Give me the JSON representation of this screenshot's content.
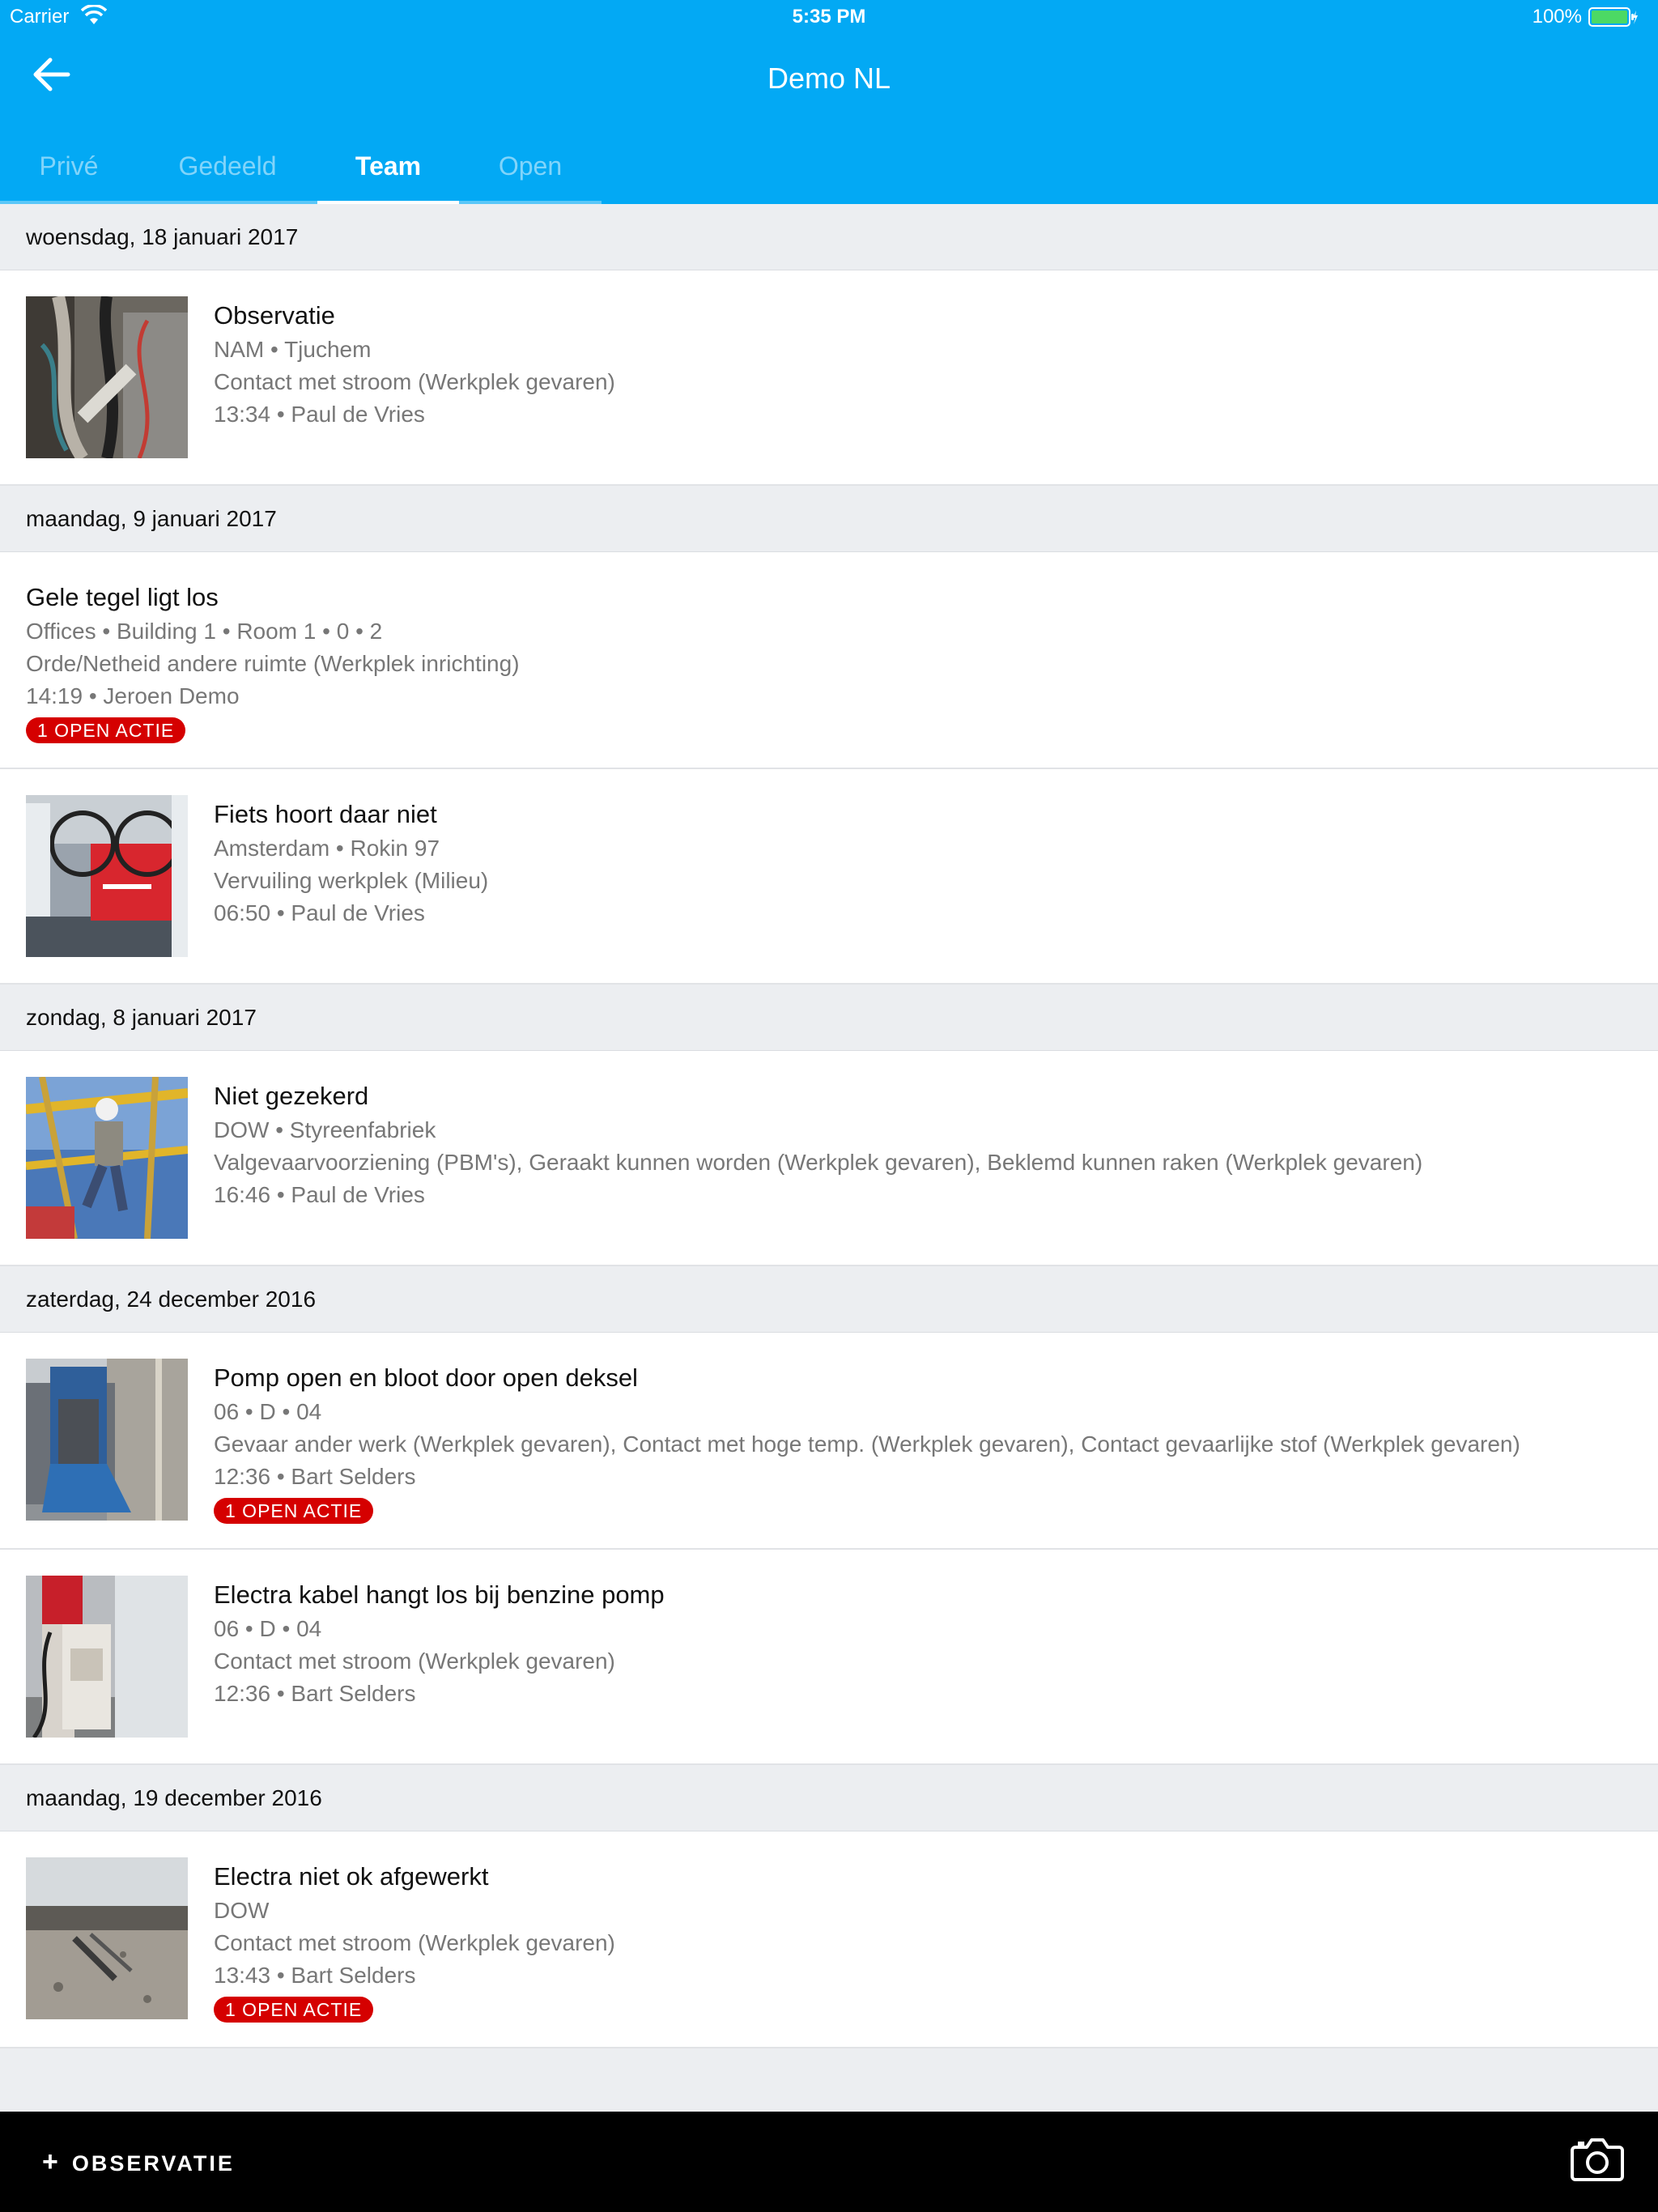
{
  "status_bar": {
    "carrier": "Carrier",
    "time": "5:35 PM",
    "battery": "100%"
  },
  "nav": {
    "title": "Demo NL",
    "back_icon": "arrow-left-icon"
  },
  "tabs": [
    {
      "label": "Privé",
      "active": false
    },
    {
      "label": "Gedeeld",
      "active": false
    },
    {
      "label": "Team",
      "active": true
    },
    {
      "label": "Open",
      "active": false
    }
  ],
  "colors": {
    "primary": "#03A9F4",
    "badge": "#D50000",
    "section_bg": "#ECEEF1",
    "bottom_bar": "#000000"
  },
  "sections": [
    {
      "date": "woensdag, 18 januari 2017",
      "items": [
        {
          "title": "Observatie",
          "location": "NAM • Tjuchem",
          "category": "Contact met stroom (Werkplek gevaren)",
          "meta": "13:34 • Paul de Vries",
          "badge": "",
          "has_photo": true
        }
      ]
    },
    {
      "date": "maandag, 9 januari 2017",
      "items": [
        {
          "title": "Gele tegel ligt los",
          "location": "Offices • Building 1 • Room 1 • 0 • 2",
          "category": "Orde/Netheid andere ruimte (Werkplek inrichting)",
          "meta": "14:19 • Jeroen Demo",
          "badge": "1 OPEN ACTIE",
          "has_photo": false
        },
        {
          "title": "Fiets hoort daar niet",
          "location": "Amsterdam • Rokin 97",
          "category": "Vervuiling werkplek (Milieu)",
          "meta": "06:50 • Paul de Vries",
          "badge": "",
          "has_photo": true
        }
      ]
    },
    {
      "date": "zondag, 8 januari 2017",
      "items": [
        {
          "title": "Niet gezekerd",
          "location": "DOW • Styreenfabriek",
          "category": "Valgevaarvoorziening (PBM's), Geraakt kunnen worden (Werkplek gevaren), Beklemd kunnen raken (Werkplek gevaren)",
          "meta": "16:46 • Paul de Vries",
          "badge": "",
          "has_photo": true
        }
      ]
    },
    {
      "date": "zaterdag, 24 december 2016",
      "items": [
        {
          "title": "Pomp open en bloot door open deksel",
          "location": "06 • D • 04",
          "category": "Gevaar ander werk (Werkplek gevaren), Contact met hoge temp. (Werkplek gevaren), Contact gevaarlijke stof (Werkplek gevaren)",
          "meta": "12:36 • Bart Selders",
          "badge": "1 OPEN ACTIE",
          "has_photo": true
        },
        {
          "title": "Electra kabel hangt los bij benzine pomp",
          "location": "06 • D • 04",
          "category": "Contact met stroom (Werkplek gevaren)",
          "meta": "12:36 • Bart Selders",
          "badge": "",
          "has_photo": true
        }
      ]
    },
    {
      "date": "maandag, 19 december 2016",
      "items": [
        {
          "title": "Electra niet ok afgewerkt",
          "location": "DOW",
          "category": "Contact met stroom (Werkplek gevaren)",
          "meta": "13:43 • Bart Selders",
          "badge": "1 OPEN ACTIE",
          "has_photo": true
        }
      ]
    }
  ],
  "bottom_bar": {
    "add_label": "OBSERVATIE",
    "add_symbol": "+",
    "camera_icon": "camera-icon"
  }
}
